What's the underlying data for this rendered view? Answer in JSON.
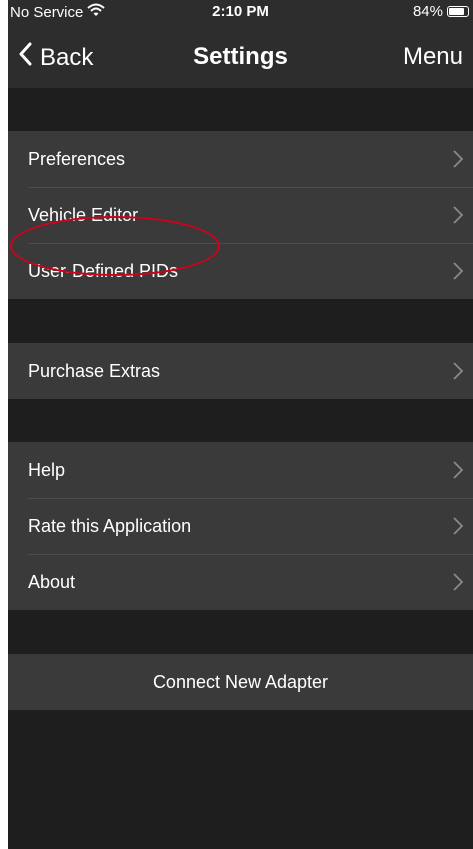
{
  "status_bar": {
    "carrier": "No Service",
    "time": "2:10 PM",
    "battery": "84%",
    "battery_level": 0.84
  },
  "nav": {
    "back_label": "Back",
    "title": "Settings",
    "menu_label": "Menu"
  },
  "sections": [
    {
      "items": [
        {
          "label": "Preferences"
        },
        {
          "label": "Vehicle Editor"
        },
        {
          "label": "User-Defined PIDs"
        }
      ]
    },
    {
      "items": [
        {
          "label": "Purchase Extras"
        }
      ]
    },
    {
      "items": [
        {
          "label": "Help"
        },
        {
          "label": "Rate this Application"
        },
        {
          "label": "About"
        }
      ]
    },
    {
      "items": [
        {
          "label": "Connect New Adapter"
        }
      ]
    }
  ],
  "colors": {
    "background": "#1e1e1e",
    "bar": "#2d2d2d",
    "row": "#3a3a3a",
    "chevron": "#8a8a8a",
    "highlight": "#d0021b"
  }
}
